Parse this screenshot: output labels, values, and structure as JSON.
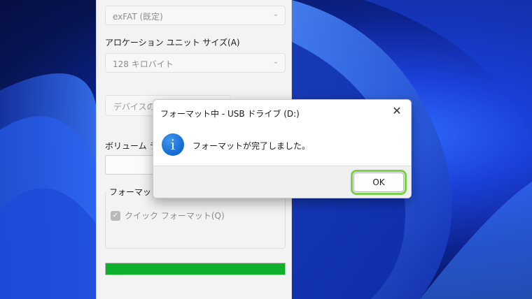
{
  "format_window": {
    "filesystem_value": "exFAT (既定)",
    "allocation_label": "アロケーション ユニット サイズ(A)",
    "allocation_value": "128 キロバイト",
    "restore_defaults_label": "デバイスの既",
    "volume_label": "ボリューム ラベ",
    "volume_value": "",
    "options_group_label": "フォーマット オ",
    "quick_format_label": "クイック フォーマット(Q)",
    "progress": 1.0
  },
  "message_box": {
    "title": "フォーマット中 - USB ドライブ (D:)",
    "close_glyph": "✕",
    "icon_glyph": "i",
    "message": "フォーマットが完了しました。",
    "ok_label": "OK"
  }
}
